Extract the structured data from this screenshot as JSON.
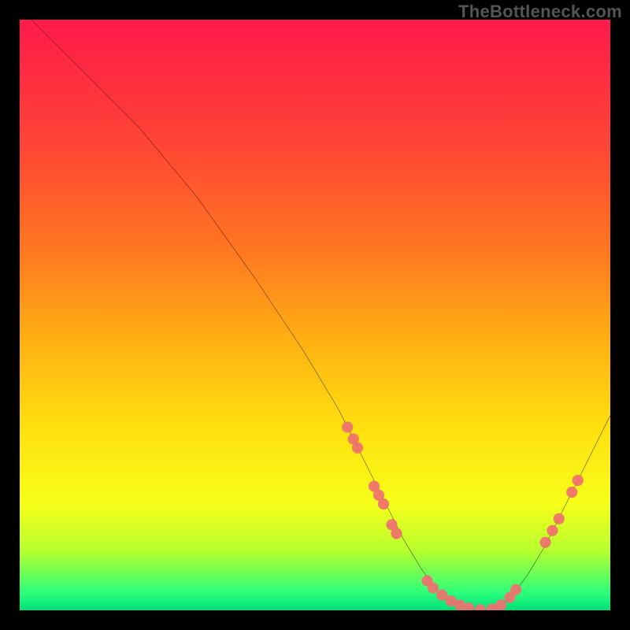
{
  "watermark": "TheBottleneck.com",
  "chart_data": {
    "type": "line",
    "title": "",
    "xlabel": "",
    "ylabel": "",
    "xlim": [
      0,
      100
    ],
    "ylim": [
      0,
      100
    ],
    "grid": false,
    "legend": false,
    "gradient_stops": [
      {
        "offset": 0.0,
        "color": "#ff1a4b"
      },
      {
        "offset": 0.2,
        "color": "#ff4236"
      },
      {
        "offset": 0.4,
        "color": "#ff7a1f"
      },
      {
        "offset": 0.55,
        "color": "#ffb312"
      },
      {
        "offset": 0.7,
        "color": "#ffe20f"
      },
      {
        "offset": 0.82,
        "color": "#f7ff1a"
      },
      {
        "offset": 0.9,
        "color": "#b6ff2e"
      },
      {
        "offset": 0.97,
        "color": "#2cff7a"
      },
      {
        "offset": 1.0,
        "color": "#00e07a"
      }
    ],
    "series": [
      {
        "name": "bottleneck-curve",
        "type": "line",
        "color": "#000000",
        "x": [
          2,
          6,
          12,
          20,
          30,
          40,
          48,
          54,
          58,
          62,
          65,
          68,
          71,
          74,
          77,
          80,
          83,
          86,
          89,
          92,
          95,
          98,
          100
        ],
        "y": [
          100,
          96,
          90,
          82,
          70,
          56,
          44,
          34,
          26,
          18,
          12,
          7,
          3,
          1,
          0,
          0,
          2,
          6,
          11,
          17,
          23,
          29,
          33
        ]
      },
      {
        "name": "left-cluster-markers",
        "type": "scatter",
        "color": "#f07070",
        "x": [
          55.5,
          56.5,
          57.2,
          60.0,
          60.8,
          61.6,
          63.0,
          63.8
        ],
        "y": [
          31.0,
          29.0,
          27.5,
          21.0,
          19.5,
          18.0,
          14.5,
          13.0
        ]
      },
      {
        "name": "bottom-cluster-markers",
        "type": "scatter",
        "color": "#f07070",
        "x": [
          69.0,
          70.0,
          71.5,
          73.0,
          74.5,
          76.0,
          78.0,
          80.0,
          81.5,
          83.0,
          84.0
        ],
        "y": [
          5.0,
          3.8,
          2.6,
          1.6,
          0.9,
          0.4,
          0.1,
          0.2,
          0.9,
          2.2,
          3.5
        ]
      },
      {
        "name": "right-cluster-markers",
        "type": "scatter",
        "color": "#f07070",
        "x": [
          89.0,
          90.2,
          91.3,
          93.5,
          94.5
        ],
        "y": [
          11.5,
          13.5,
          15.5,
          20.0,
          22.0
        ]
      }
    ]
  }
}
